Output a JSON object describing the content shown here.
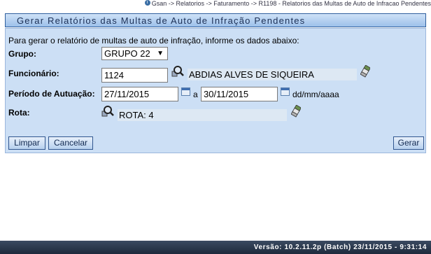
{
  "breadcrumb": {
    "path": "Gsan -> Relatorios -> Faturamento -> R1198 - Relatorios das Multas de Auto de Infracao Pendentes"
  },
  "page": {
    "title": "Gerar Relatórios das Multas de Auto de Infração Pendentes",
    "intro": "Para gerar o relatório de multas de auto de infração, informe os dados abaixo:"
  },
  "form": {
    "grupo": {
      "label": "Grupo:",
      "value": "GRUPO 22"
    },
    "funcionario": {
      "label": "Funcionário:",
      "code": "1124",
      "name": "ABDIAS ALVES DE SIQUEIRA"
    },
    "periodo": {
      "label": "Período de Autuação:",
      "start": "27/11/2015",
      "separator": "a",
      "end": "30/11/2015",
      "format_hint": "dd/mm/aaaa"
    },
    "rota": {
      "label": "Rota:",
      "value": "ROTA: 4"
    }
  },
  "buttons": {
    "limpar": "Limpar",
    "cancelar": "Cancelar",
    "gerar": "Gerar"
  },
  "footer": {
    "version": "Versão: 10.2.11.2p (Batch) 23/11/2015 - 9:31:14"
  },
  "icons": {
    "breadcrumb": "info-icon",
    "search": "magnifier-icon",
    "clear": "eraser-icon",
    "calendar": "calendar-icon"
  },
  "colors": {
    "panel_background": "#ccdff5",
    "title_bar": "#9cc0ea",
    "footer_background": "#1e2a3c"
  }
}
